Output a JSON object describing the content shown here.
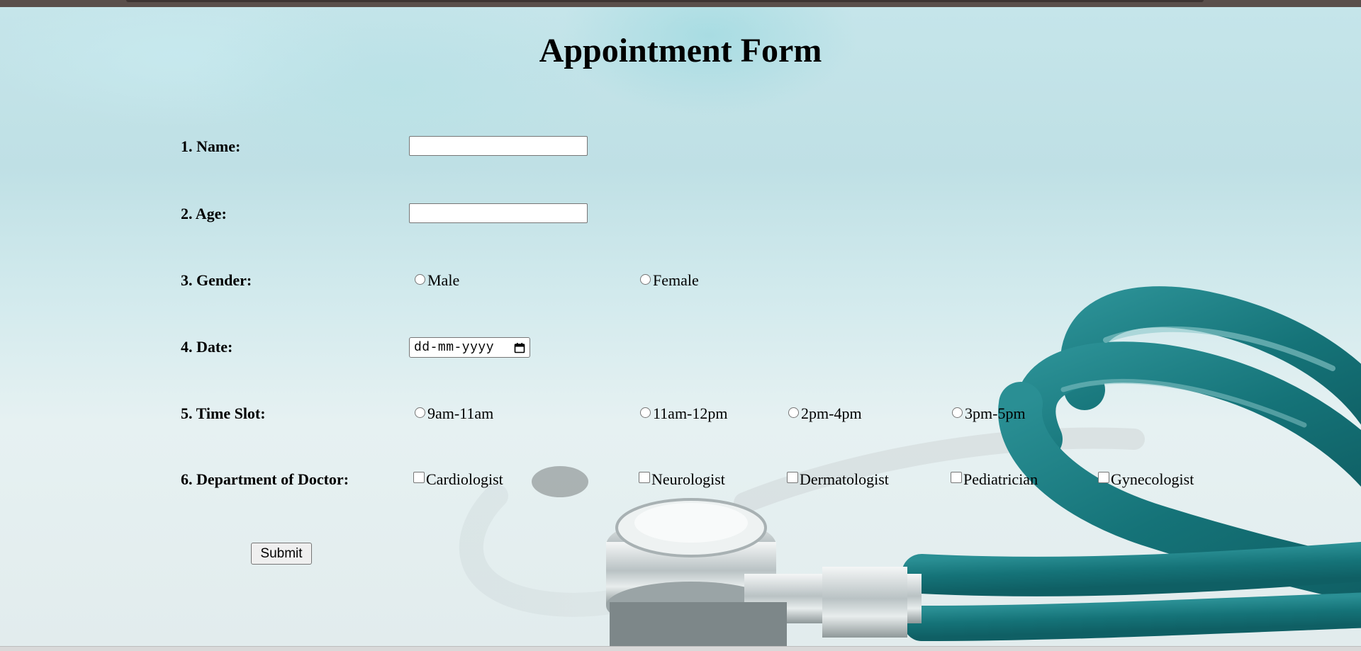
{
  "page": {
    "title": "Appointment Form"
  },
  "form": {
    "name": {
      "label": "1. Name:",
      "value": ""
    },
    "age": {
      "label": "2. Age:",
      "value": ""
    },
    "gender": {
      "label": "3. Gender:",
      "options": [
        "Male",
        "Female"
      ]
    },
    "date": {
      "label": "4. Date:",
      "placeholder": "dd-mm-yyyy"
    },
    "time_slot": {
      "label": "5. Time Slot:",
      "options": [
        "9am-11am",
        "11am-12pm",
        "2pm-4pm",
        "3pm-5pm"
      ]
    },
    "department": {
      "label": "6. Department of Doctor:",
      "options": [
        "Cardiologist",
        "Neurologist",
        "Dermatologist",
        "Pediatrician",
        "Gynecologist"
      ]
    },
    "submit_label": "Submit"
  },
  "icons": {
    "date_picker": "calendar-icon"
  },
  "colors": {
    "stethoscope_tube": "#1b7b80",
    "background_tint": "#c5e5ea"
  }
}
